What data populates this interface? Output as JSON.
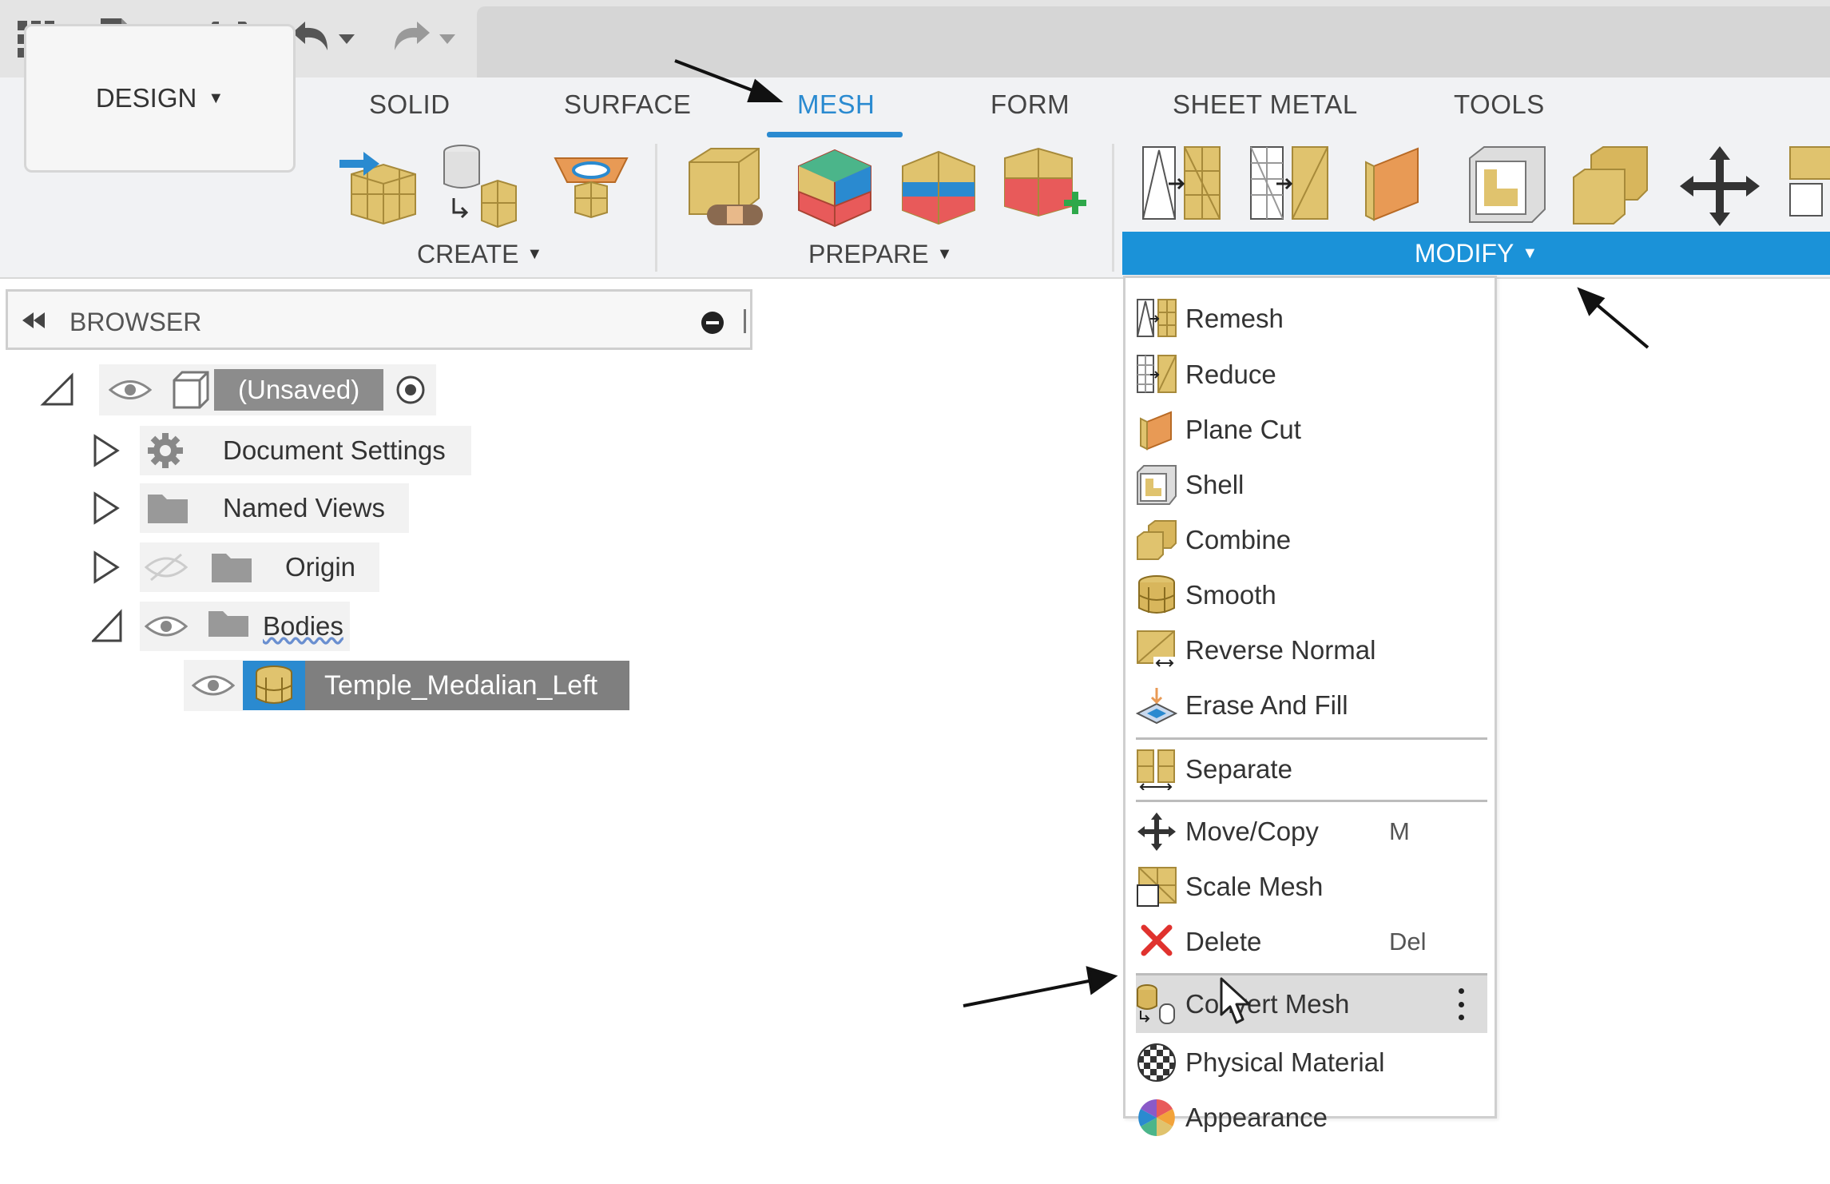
{
  "quick_access": {
    "icons": [
      "grid-icon",
      "file-icon",
      "save-icon",
      "undo-icon",
      "redo-icon"
    ]
  },
  "ribbon": {
    "workspace_label": "DESIGN",
    "tabs": [
      {
        "label": "SOLID"
      },
      {
        "label": "SURFACE"
      },
      {
        "label": "MESH"
      },
      {
        "label": "FORM"
      },
      {
        "label": "SHEET METAL"
      },
      {
        "label": "TOOLS"
      }
    ],
    "active_tab": "MESH",
    "groups": {
      "create": "CREATE",
      "prepare": "PREPARE",
      "modify": "MODIFY"
    },
    "colors": {
      "accent": "#1b92d8",
      "mesh_gold": "#e0c36e",
      "active_tab": "#2a8ad0"
    }
  },
  "browser": {
    "title": "BROWSER",
    "root": "(Unsaved)",
    "items": [
      {
        "label": "Document Settings"
      },
      {
        "label": "Named Views"
      },
      {
        "label": "Origin"
      },
      {
        "label": "Bodies"
      }
    ],
    "body": "Temple_Medalian_Left"
  },
  "modify_menu": {
    "items": [
      {
        "label": "Remesh",
        "shortcut": ""
      },
      {
        "label": "Reduce",
        "shortcut": ""
      },
      {
        "label": "Plane Cut",
        "shortcut": ""
      },
      {
        "label": "Shell",
        "shortcut": ""
      },
      {
        "label": "Combine",
        "shortcut": ""
      },
      {
        "label": "Smooth",
        "shortcut": ""
      },
      {
        "label": "Reverse Normal",
        "shortcut": ""
      },
      {
        "label": "Erase And Fill",
        "shortcut": ""
      },
      {
        "label": "Separate",
        "shortcut": ""
      },
      {
        "label": "Move/Copy",
        "shortcut": "M"
      },
      {
        "label": "Scale Mesh",
        "shortcut": ""
      },
      {
        "label": "Delete",
        "shortcut": "Del"
      },
      {
        "label": "Convert Mesh",
        "shortcut": ""
      },
      {
        "label": "Physical Material",
        "shortcut": ""
      },
      {
        "label": "Appearance",
        "shortcut": ""
      }
    ],
    "highlighted": "Convert Mesh"
  }
}
